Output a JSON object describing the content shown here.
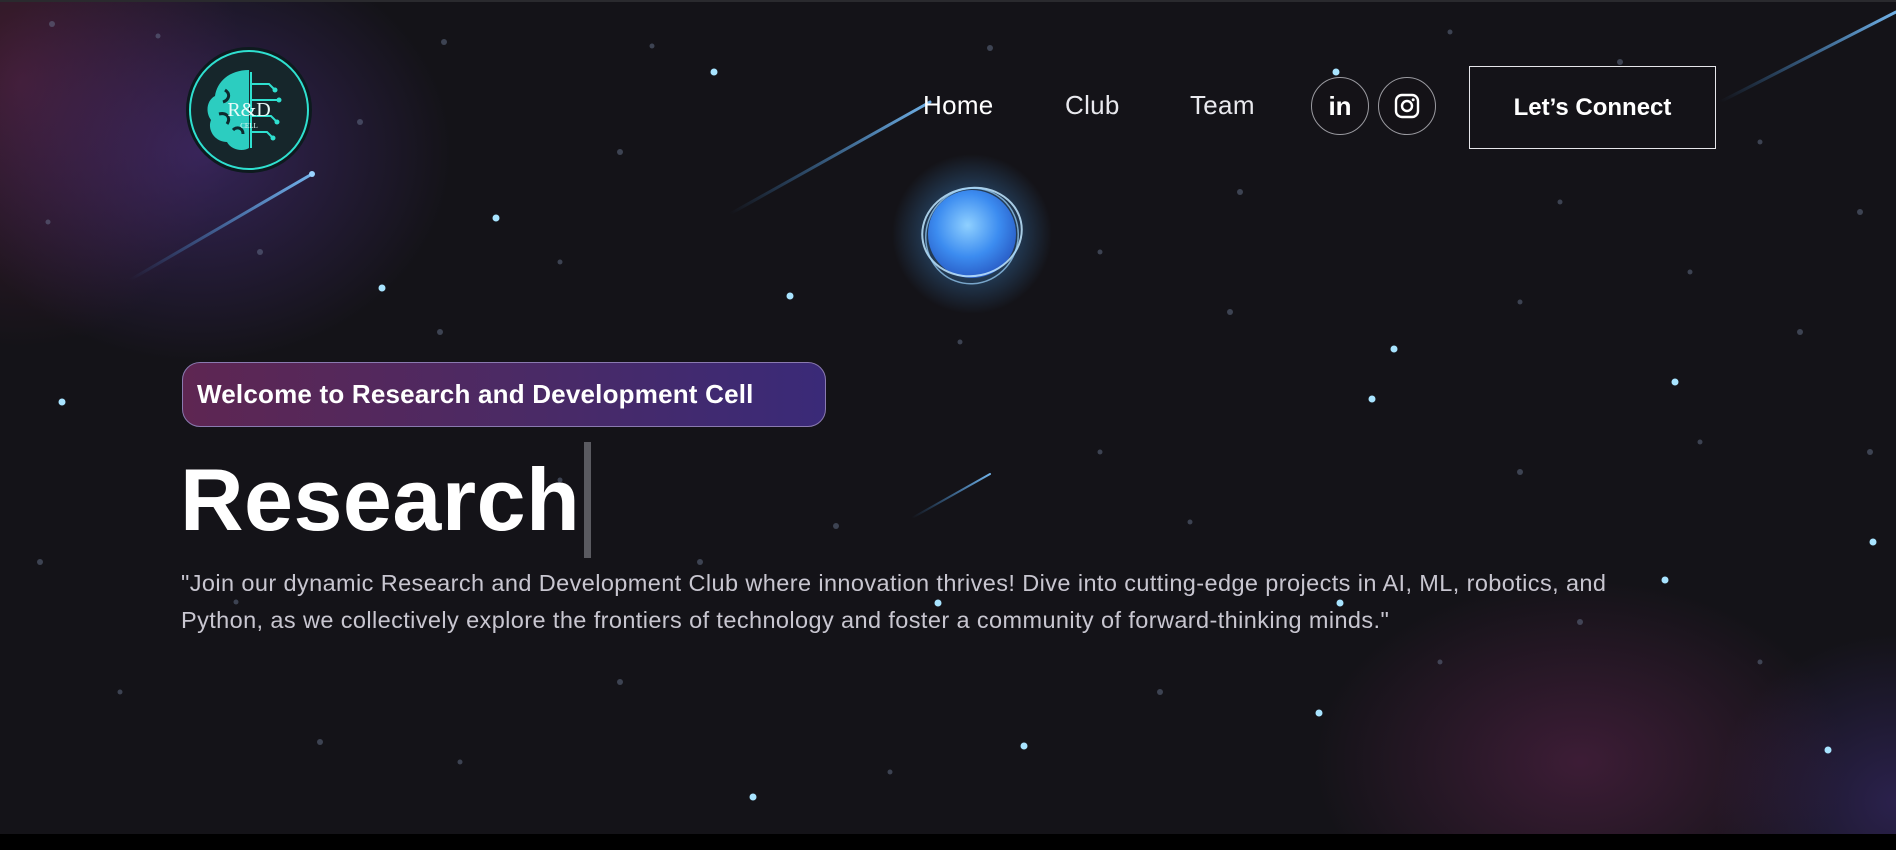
{
  "brand": {
    "logo_text": "R&D",
    "logo_subtext": "CELL"
  },
  "nav": {
    "links": [
      {
        "label": "Home"
      },
      {
        "label": "Club"
      },
      {
        "label": "Team"
      }
    ],
    "social": [
      {
        "label": "in",
        "icon": "linkedin-icon"
      },
      {
        "icon": "instagram-icon"
      }
    ],
    "cta_label": "Let’s Connect"
  },
  "hero": {
    "badge": "Welcome to Research and Development Cell",
    "headline": "Research",
    "description": "\"Join our dynamic Research and Development Club where innovation thrives! Dive into cutting-edge projects in AI, ML, robotics, and Python, as we collectively explore the frontiers of technology and foster a community of forward-thinking minds.\""
  },
  "colors": {
    "background": "#141318",
    "accent_teal": "#2fe0d0",
    "badge_gradient_start": "#5e2652",
    "badge_gradient_end": "#3a2a78",
    "orb_blue": "#4aa8ff"
  }
}
